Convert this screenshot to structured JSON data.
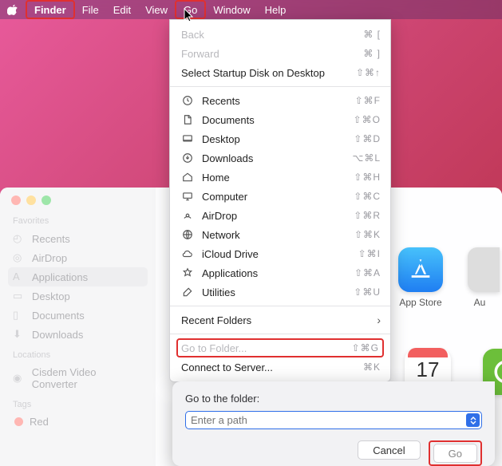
{
  "menubar": {
    "items": [
      "Finder",
      "File",
      "Edit",
      "View",
      "Go",
      "Window",
      "Help"
    ]
  },
  "dropdown": {
    "back": {
      "label": "Back",
      "shortcut": "⌘ ["
    },
    "forward": {
      "label": "Forward",
      "shortcut": "⌘ ]"
    },
    "startup": {
      "label": "Select Startup Disk on Desktop",
      "shortcut": "⇧⌘↑"
    },
    "items": [
      {
        "icon": "clock-icon",
        "label": "Recents",
        "shortcut": "⇧⌘F"
      },
      {
        "icon": "doc-icon",
        "label": "Documents",
        "shortcut": "⇧⌘O"
      },
      {
        "icon": "desktop-icon",
        "label": "Desktop",
        "shortcut": "⇧⌘D"
      },
      {
        "icon": "download-icon",
        "label": "Downloads",
        "shortcut": "⌥⌘L"
      },
      {
        "icon": "home-icon",
        "label": "Home",
        "shortcut": "⇧⌘H"
      },
      {
        "icon": "computer-icon",
        "label": "Computer",
        "shortcut": "⇧⌘C"
      },
      {
        "icon": "airdrop-icon",
        "label": "AirDrop",
        "shortcut": "⇧⌘R"
      },
      {
        "icon": "network-icon",
        "label": "Network",
        "shortcut": "⇧⌘K"
      },
      {
        "icon": "icloud-icon",
        "label": "iCloud Drive",
        "shortcut": "⇧⌘I"
      },
      {
        "icon": "apps-icon",
        "label": "Applications",
        "shortcut": "⇧⌘A"
      },
      {
        "icon": "utilities-icon",
        "label": "Utilities",
        "shortcut": "⇧⌘U"
      }
    ],
    "recent": {
      "label": "Recent Folders"
    },
    "goto": {
      "label": "Go to Folder...",
      "shortcut": "⇧⌘G"
    },
    "connect": {
      "label": "Connect to Server...",
      "shortcut": "⌘K"
    }
  },
  "sidebar": {
    "section1": "Favorites",
    "items": [
      {
        "label": "Recents"
      },
      {
        "label": "AirDrop"
      },
      {
        "label": "Applications"
      },
      {
        "label": "Desktop"
      },
      {
        "label": "Documents"
      },
      {
        "label": "Downloads"
      }
    ],
    "section2": "Locations",
    "loc_item": "Cisdem Video Converter",
    "section3": "Tags",
    "tag_item": "Red"
  },
  "apps": {
    "appstore": "App Store",
    "au": "Au",
    "cal_day": "17"
  },
  "dialog": {
    "title": "Go to the folder:",
    "placeholder": "Enter a path",
    "cancel": "Cancel",
    "go": "Go"
  }
}
